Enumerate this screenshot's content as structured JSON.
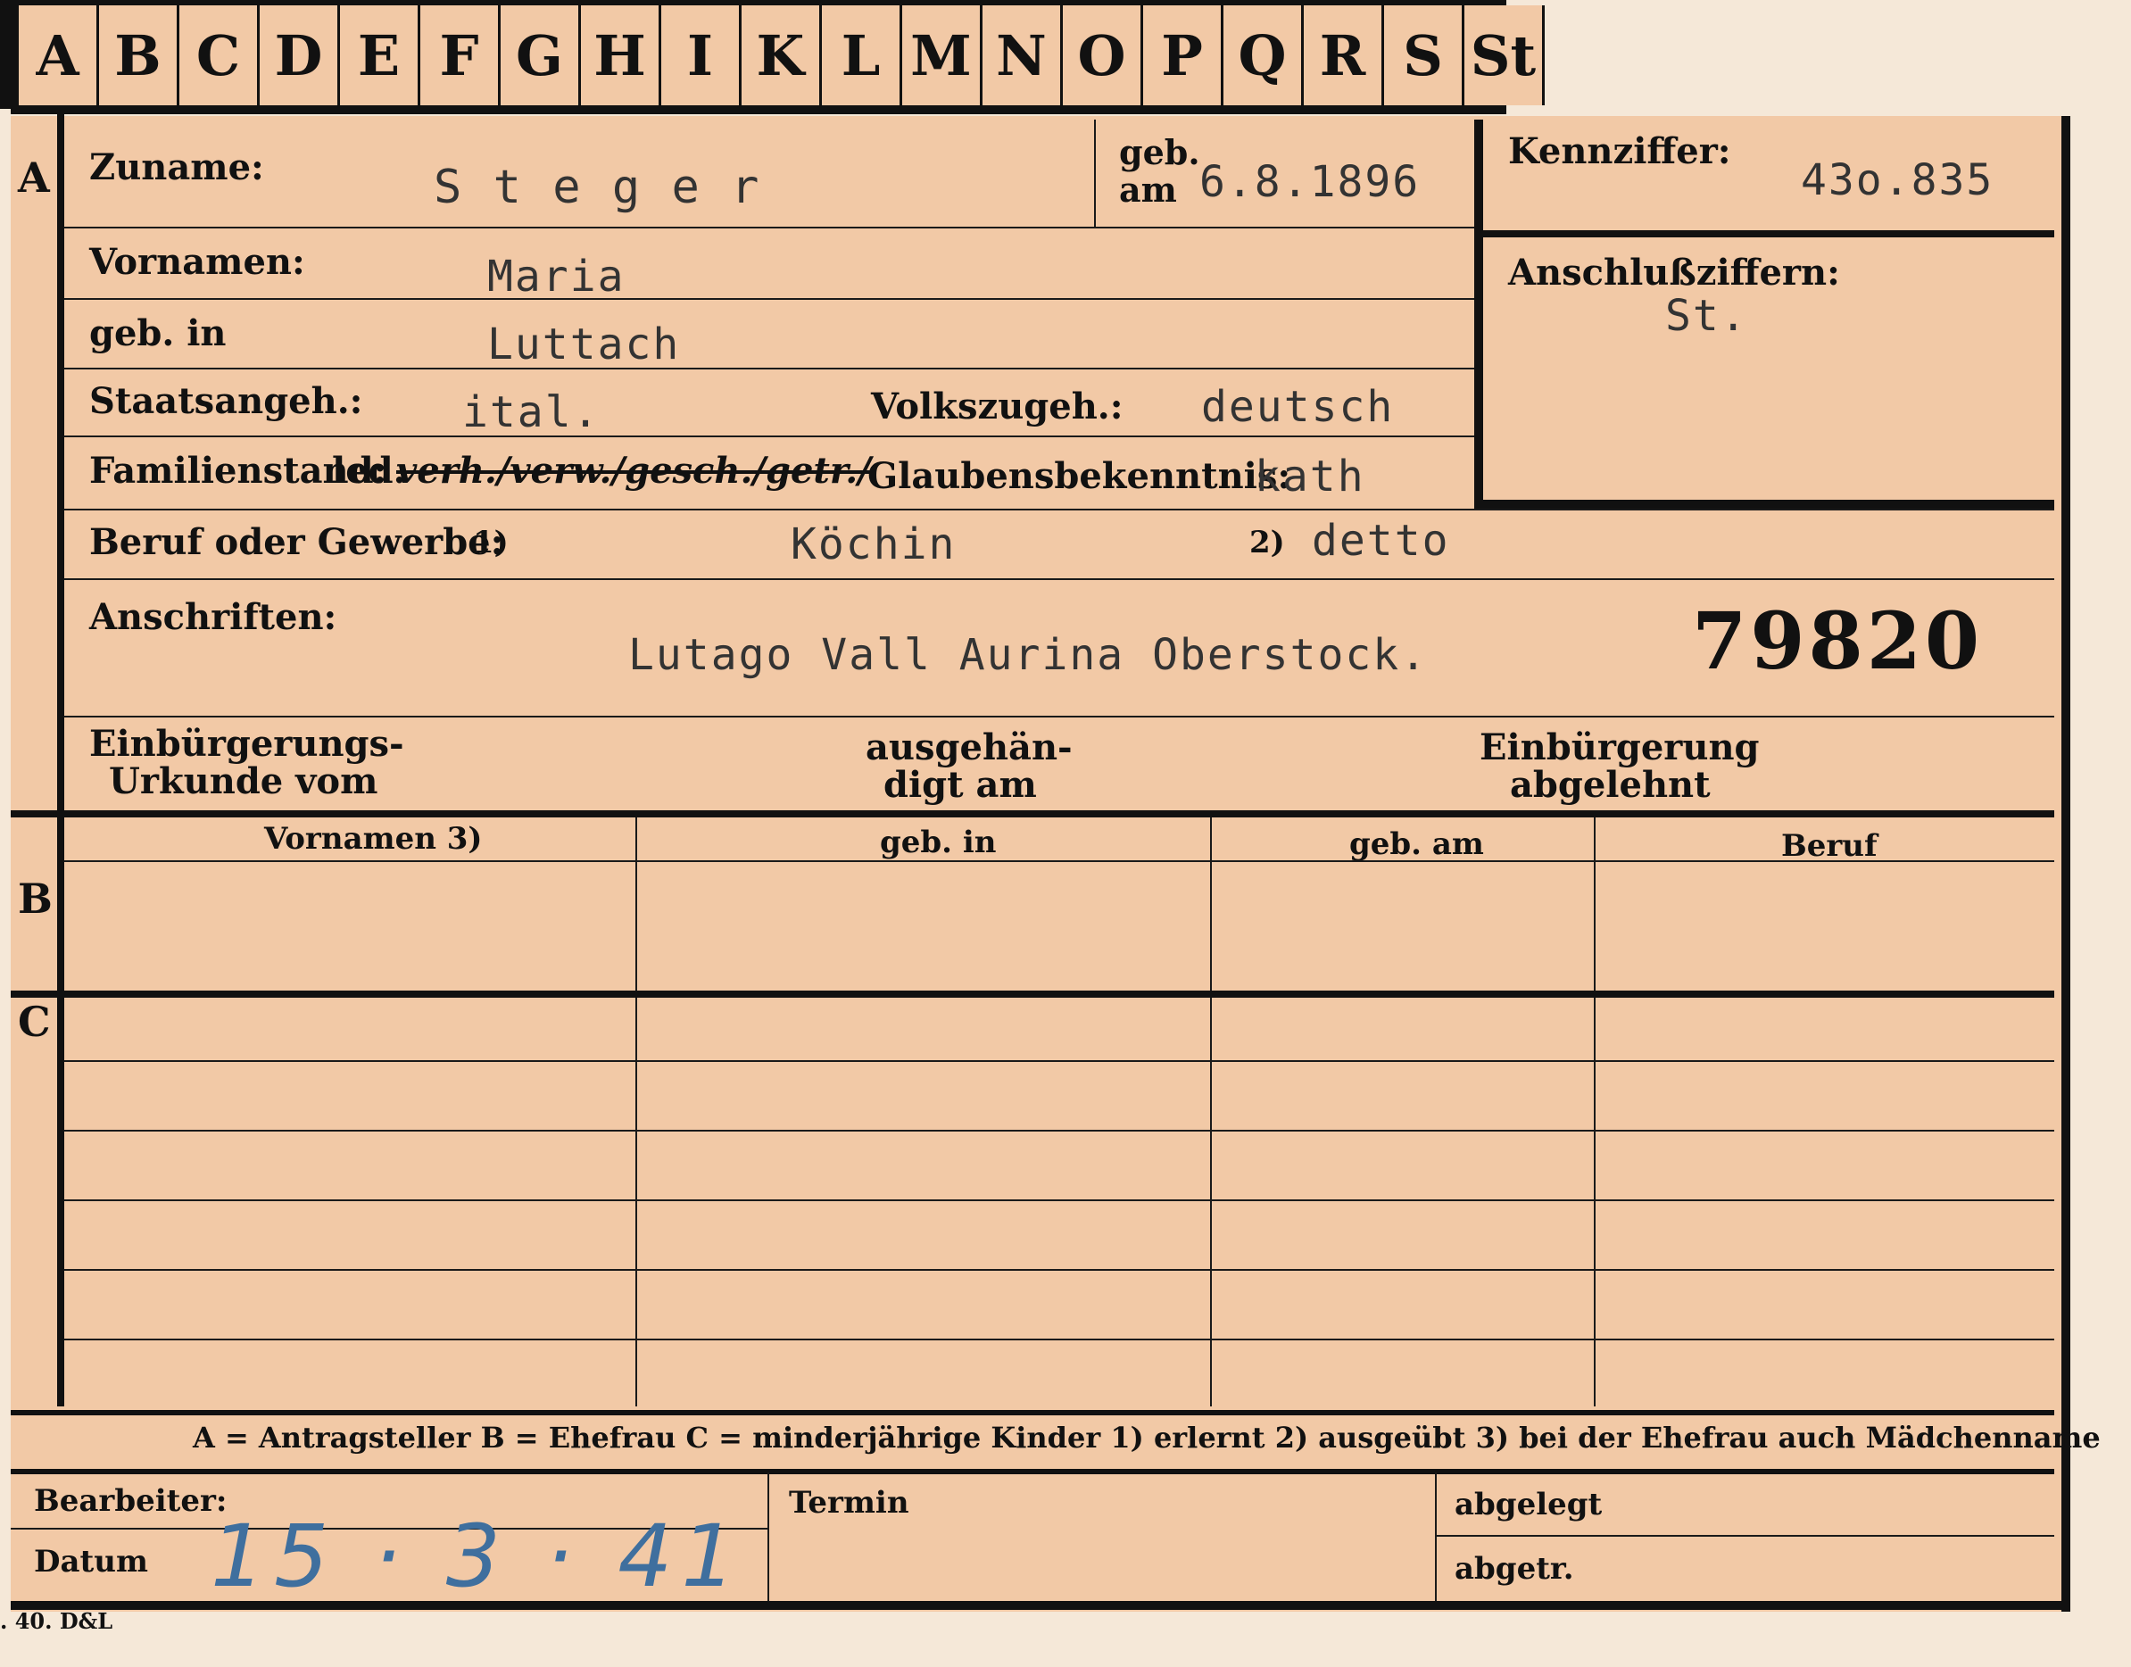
{
  "tabs": [
    "A",
    "B",
    "C",
    "D",
    "E",
    "F",
    "G",
    "H",
    "I",
    "K",
    "L",
    "M",
    "N",
    "O",
    "P",
    "Q",
    "R",
    "S",
    "St"
  ],
  "section_a": {
    "marker": "A",
    "zuname_label": "Zuname:",
    "zuname_value": "S t e g e r",
    "geb_am_label_top": "geb.",
    "geb_am_label_bottom": "am",
    "geb_am_value": "6.8.1896",
    "kennziffer_label": "Kennziffer:",
    "kennziffer_value": "43o.835",
    "anschluss_label": "Anschlußziffern:",
    "anschluss_value": "St.",
    "vornamen_label": "Vornamen:",
    "vornamen_value": "Maria",
    "geb_in_label": "geb. in",
    "geb_in_value": "Luttach",
    "staatsangeh_label": "Staatsangeh.:",
    "staatsangeh_value": "ital.",
    "volkszugeh_label": "Volkszugeh.:",
    "volkszugeh_value": "deutsch",
    "familienstand_label": "Familienstand:",
    "familienstand_led": "led.",
    "familienstand_struck": "verh./verw./gesch./getr./",
    "glaubens_label": "Glaubensbekenntnis:",
    "glaubens_value": "kath",
    "beruf_label": "Beruf oder Gewerbe:",
    "beruf_note1": "1)",
    "beruf_value1": "Köchin",
    "beruf_note2": "2)",
    "beruf_value2": "detto",
    "anschriften_label": "Anschriften:",
    "anschriften_value": "Lutago  Vall Aurina  Oberstock.",
    "stamp_number": "79820",
    "einb_urkunde_line1": "Einbürgerungs-",
    "einb_urkunde_line2": "Urkunde vom",
    "ausgehaendigt_line1": "ausgehän-",
    "ausgehaendigt_line2": "digt am",
    "einb_abgelehnt_line1": "Einbürgerung",
    "einb_abgelehnt_line2": "abgelehnt"
  },
  "section_b": {
    "marker": "B",
    "columns": [
      "Vornamen 3)",
      "geb. in",
      "geb. am",
      "Beruf"
    ]
  },
  "section_c": {
    "marker": "C"
  },
  "legend": "A = Antragsteller   B = Ehefrau   C = minderjährige Kinder   1) erlernt   2) ausgeübt   3) bei der Ehefrau auch Mädchenname",
  "footer": {
    "bearbeiter_label": "Bearbeiter:",
    "datum_label": "Datum",
    "datum_value": "15 · 3 · 41",
    "termin_label": "Termin",
    "abgelegt_label": "abgelegt",
    "abgetr_label": "abgetr."
  },
  "printer_mark": ". 40. D&L"
}
